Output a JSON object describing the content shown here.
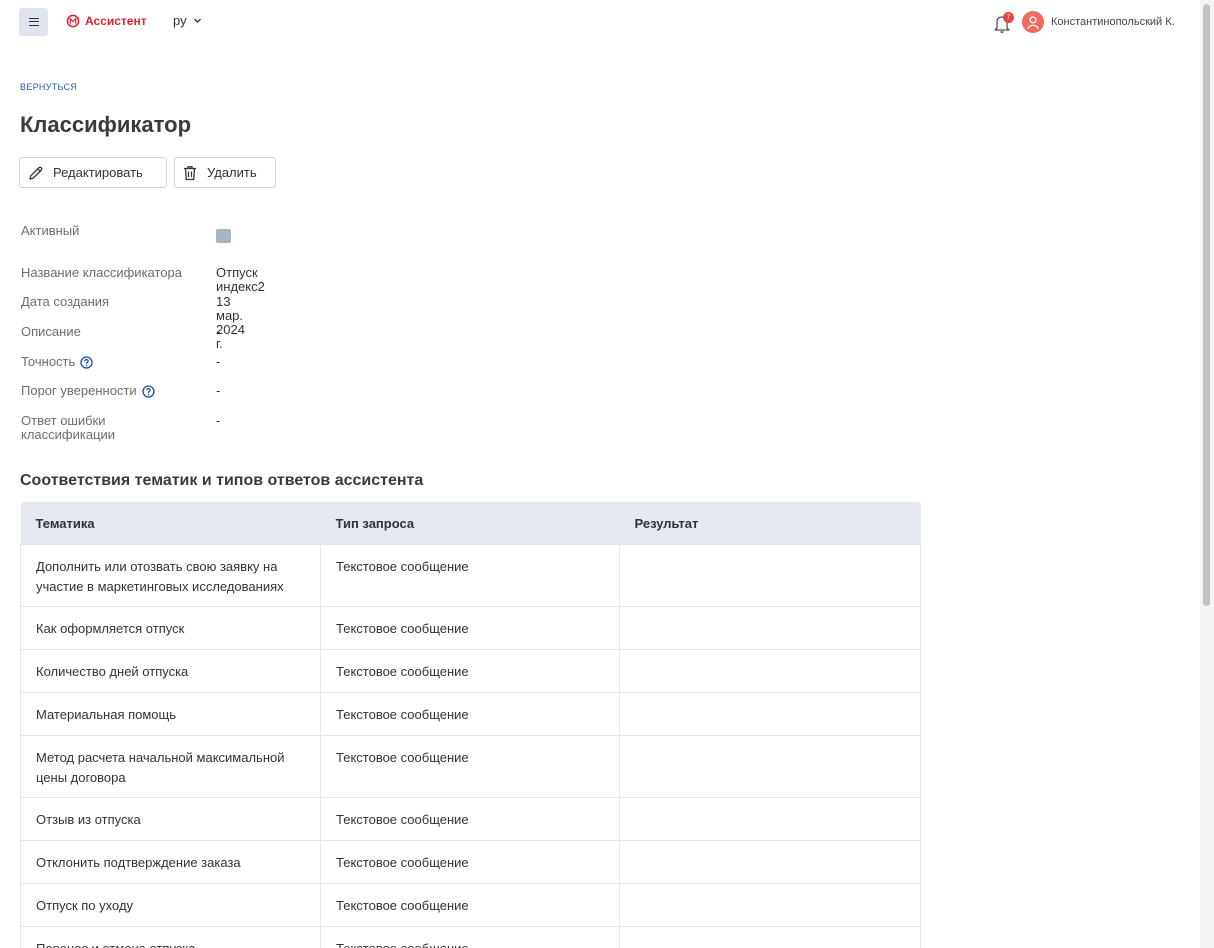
{
  "header": {
    "brand": "Ассистент",
    "language": "ру",
    "notifications_count": "7",
    "user_name": "Константинопольский К."
  },
  "back_link": "ВЕРНУТЬСЯ",
  "page_title": "Классификатор",
  "actions": {
    "edit_label": "Редактировать",
    "delete_label": "Удалить"
  },
  "fields": {
    "active_label": "Активный",
    "active_checked": true,
    "name_label": "Название классификатора",
    "name_value": "Отпуск индекс2",
    "created_label": "Дата создания",
    "created_value": "13 мар. 2024 г.",
    "description_label": "Описание",
    "description_value": "-",
    "accuracy_label": "Точность",
    "accuracy_value": "-",
    "threshold_label": "Порог уверенности",
    "threshold_value": "-",
    "error_answer_label": "Ответ ошибки классификации",
    "error_answer_value": "-"
  },
  "section_title": "Соответствия тематик и типов ответов ассистента",
  "table": {
    "columns": [
      "Тематика",
      "Тип запроса",
      "Результат"
    ],
    "rows": [
      {
        "topic": "Дополнить или отозвать свою заявку на участие в маркетинговых исследованиях",
        "type": "Текстовое сообщение",
        "result": ""
      },
      {
        "topic": "Как оформляется отпуск",
        "type": "Текстовое сообщение",
        "result": ""
      },
      {
        "topic": "Количество дней отпуска",
        "type": "Текстовое сообщение",
        "result": ""
      },
      {
        "topic": "Материальная помощь",
        "type": "Текстовое сообщение",
        "result": ""
      },
      {
        "topic": "Метод расчета начальной максимальной цены договора",
        "type": "Текстовое сообщение",
        "result": ""
      },
      {
        "topic": "Отзыв из отпуска",
        "type": "Текстовое сообщение",
        "result": ""
      },
      {
        "topic": "Отклонить подтверждение заказа",
        "type": "Текстовое сообщение",
        "result": ""
      },
      {
        "topic": "Отпуск по уходу",
        "type": "Текстовое сообщение",
        "result": ""
      },
      {
        "topic": "Перенос и отмена отпуска",
        "type": "Текстовое сообщение",
        "result": ""
      }
    ]
  },
  "colors": {
    "brand": "#d9262e",
    "link": "#2a5bb8",
    "header_row": "#e4e9f1",
    "checkbox": "#a9b4c2",
    "avatar": "#ef6a5f"
  }
}
